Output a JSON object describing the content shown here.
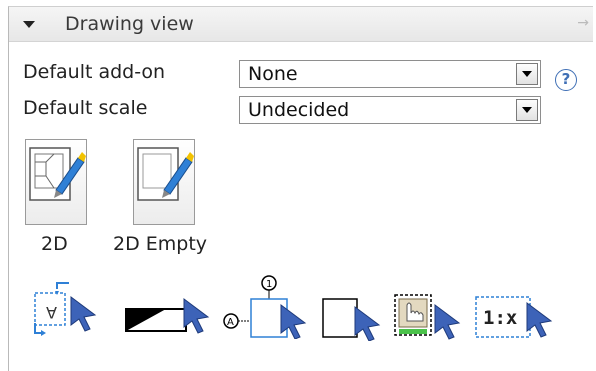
{
  "panel": {
    "title": "Drawing view"
  },
  "fields": {
    "addon_label": "Default add-on",
    "addon_value": "None",
    "scale_label": "Default scale",
    "scale_value": "Undecided"
  },
  "help": "?",
  "templates": [
    {
      "label": "2D",
      "icon": "2d-view-template-icon"
    },
    {
      "label": "2D Empty",
      "icon": "2d-empty-template-icon"
    }
  ],
  "tools": {
    "balloon_number": "1",
    "anchor_letter": "A",
    "scale_text": "1:x"
  },
  "colors": {
    "accent_blue": "#2f80d6",
    "cursor_blue": "#3d63b8",
    "green_bar": "#4ac24a"
  }
}
